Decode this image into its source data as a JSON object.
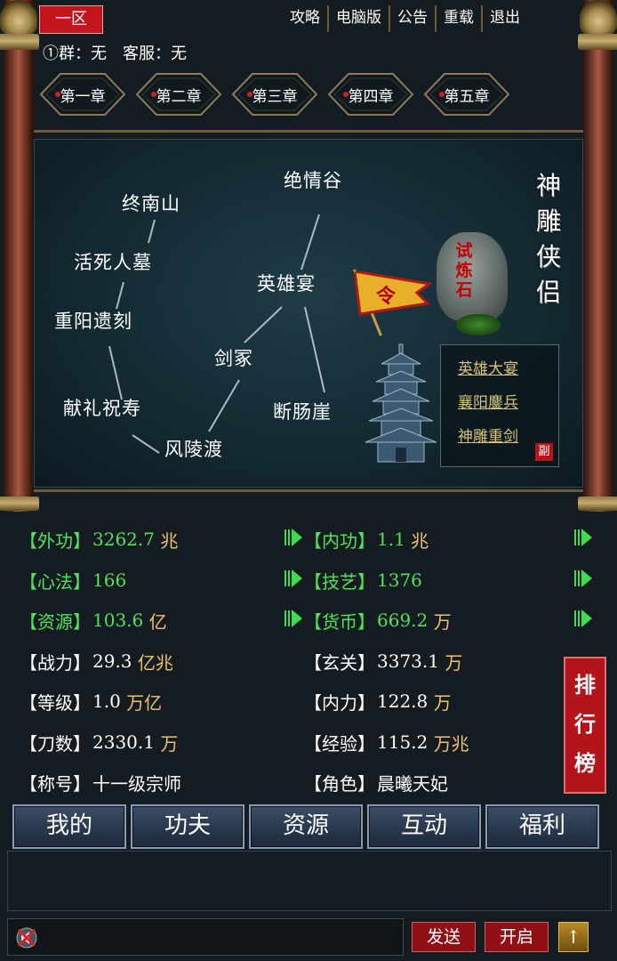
{
  "header": {
    "zone": "一区",
    "nav": [
      "攻略",
      "电脑版",
      "公告",
      "重载",
      "退出"
    ],
    "group_label": "①群：无",
    "service_label": "客服：无"
  },
  "chapters": [
    "第一章",
    "第二章",
    "第三章",
    "第四章",
    "第五章"
  ],
  "map": {
    "title_chars": [
      "神",
      "雕",
      "侠",
      "侣"
    ],
    "places": [
      "绝情谷",
      "终南山",
      "活死人墓",
      "英雄宴",
      "重阳遗刻",
      "剑冢",
      "献礼祝寿",
      "断肠崖",
      "风陵渡"
    ],
    "stone_text": [
      "试",
      "炼",
      "石"
    ],
    "flag_text": "令",
    "events": [
      "英雄大宴",
      "襄阳鏖兵",
      "神雕重剑"
    ],
    "events_badge": "副"
  },
  "stats": {
    "rows": [
      {
        "key": "【外功】",
        "value": "3262.7",
        "unit": "兆",
        "color": "green"
      },
      {
        "key": "【内功】",
        "value": "1.1",
        "unit": "兆",
        "color": "green"
      },
      {
        "key": "【心法】",
        "value": "166",
        "unit": "",
        "color": "green"
      },
      {
        "key": "【技艺】",
        "value": "1376",
        "unit": "",
        "color": "green"
      },
      {
        "key": "【资源】",
        "value": "103.6",
        "unit": "亿",
        "color": "green"
      },
      {
        "key": "【货币】",
        "value": "669.2",
        "unit": "万",
        "color": "green"
      },
      {
        "key": "【战力】",
        "value": "29.3",
        "unit": "亿兆",
        "color": "white"
      },
      {
        "key": "【玄关】",
        "value": "3373.1",
        "unit": "万",
        "color": "white"
      },
      {
        "key": "【等级】",
        "value": "1.0",
        "unit": "万亿",
        "color": "white"
      },
      {
        "key": "【内力】",
        "value": "122.8",
        "unit": "万",
        "color": "white"
      },
      {
        "key": "【刀数】",
        "value": "2330.1",
        "unit": "万",
        "color": "white"
      },
      {
        "key": "【经验】",
        "value": "115.2",
        "unit": "万兆",
        "color": "white"
      },
      {
        "key": "【称号】",
        "value": "十一级宗师",
        "unit": "",
        "color": "white"
      },
      {
        "key": "【角色】",
        "value": "晨曦天妃",
        "unit": "",
        "color": "white"
      }
    ],
    "rank_chars": [
      "排",
      "行",
      "榜"
    ]
  },
  "tabs": [
    "我的",
    "功夫",
    "资源",
    "互动",
    "福利"
  ],
  "chat": {
    "send_label": "发送",
    "open_label": "开启",
    "up_label": "↑"
  },
  "colors": {
    "accent_red": "#c3161c",
    "stat_green": "#4fe35a",
    "unit_gold": "#f0c36a",
    "event_gold": "#d8c27a"
  }
}
